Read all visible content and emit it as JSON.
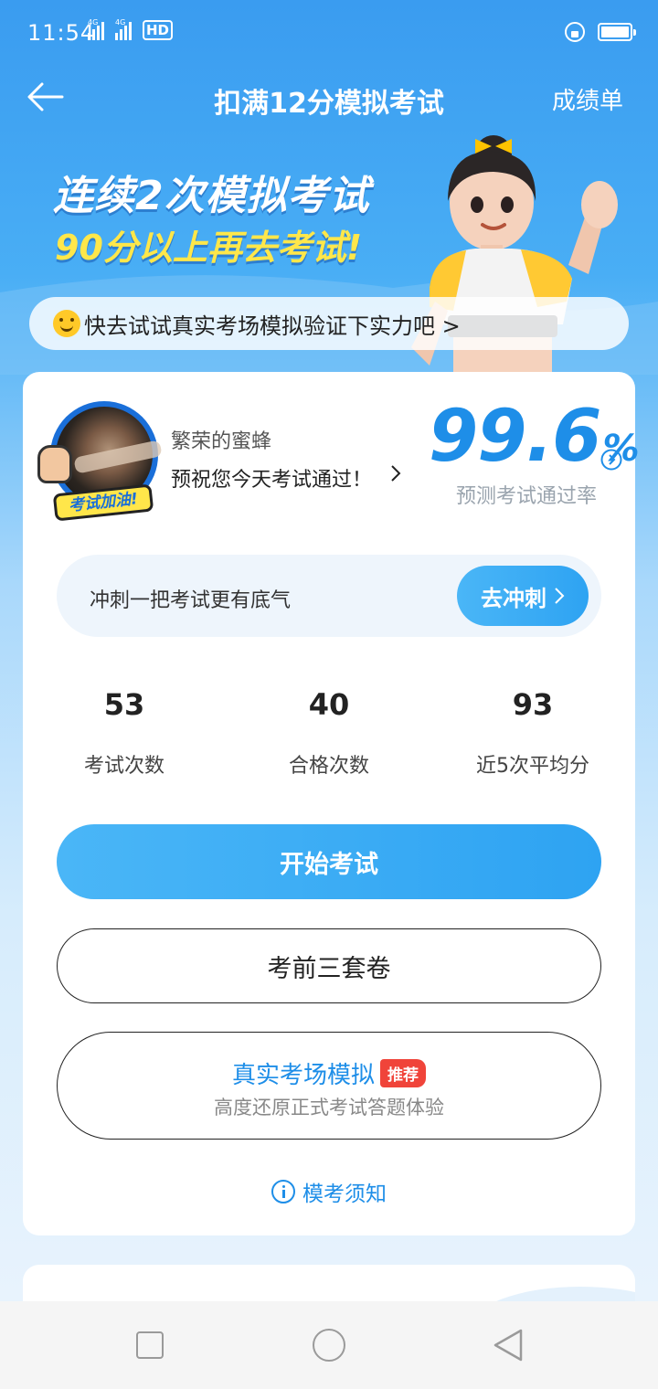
{
  "status_bar": {
    "time": "11:54",
    "net1": "4G",
    "net2": "4G",
    "hd": "HD"
  },
  "nav": {
    "title": "扣满12分模拟考试",
    "right_label": "成绩单"
  },
  "banner": {
    "line1": "连续2次模拟考试",
    "line2": "90分以上再去考试!"
  },
  "hint": {
    "text": "快去试试真实考场模拟验证下实力吧 >"
  },
  "profile": {
    "avatar_tag": "考试加油!",
    "username": "繁荣的蜜蜂",
    "wish": "预祝您今天考试通过！",
    "pass_rate": "99.6",
    "pass_rate_unit": "%",
    "pass_rate_label": "预测考试通过率"
  },
  "sprint": {
    "text": "冲刺一把考试更有底气",
    "button": "去冲刺"
  },
  "stats": [
    {
      "value": "53",
      "label": "考试次数"
    },
    {
      "value": "40",
      "label": "合格次数"
    },
    {
      "value": "93",
      "label": "近5次平均分"
    }
  ],
  "buttons": {
    "start": "开始考试",
    "papers": "考前三套卷",
    "real_title": "真实考场模拟",
    "real_badge": "推荐",
    "real_subtitle": "高度还原正式考试答题体验"
  },
  "notice": "模考须知",
  "colors": {
    "accent": "#1e8ee8",
    "badge": "#f0443a",
    "banner_highlight": "#ffe74a"
  }
}
